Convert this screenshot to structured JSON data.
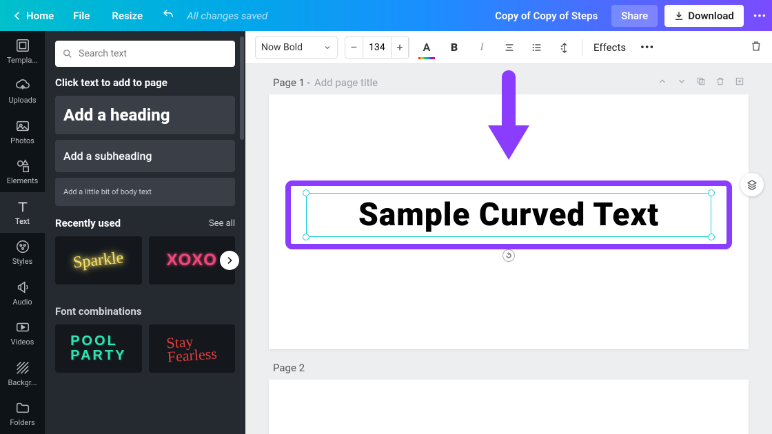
{
  "topbar": {
    "home": "Home",
    "file": "File",
    "resize": "Resize",
    "saved": "All changes saved",
    "doc_title": "Copy of Copy of Steps",
    "share": "Share",
    "download": "Download"
  },
  "rail": {
    "templates": "Templa...",
    "uploads": "Uploads",
    "photos": "Photos",
    "elements": "Elements",
    "text": "Text",
    "styles": "Styles",
    "audio": "Audio",
    "videos": "Videos",
    "background": "Backgr...",
    "folders": "Folders"
  },
  "panel": {
    "search_placeholder": "Search text",
    "click_hint": "Click text to add to page",
    "heading": "Add a heading",
    "subheading": "Add a subheading",
    "body": "Add a little bit of body text",
    "recent_label": "Recently used",
    "see_all": "See all",
    "recent_items": [
      "Sparkle",
      "XOXO"
    ],
    "combos_label": "Font combinations",
    "combo_items": [
      "POOL PARTY",
      "Stay Fearless"
    ]
  },
  "toolbar": {
    "font": "Now Bold",
    "size": "134",
    "effects": "Effects"
  },
  "canvas": {
    "page1_label": "Page 1 -",
    "page1_title_placeholder": "Add page title",
    "selected_text": "Sample Curved Text",
    "page2_label": "Page 2"
  },
  "colors": {
    "accent": "#8a3cff",
    "selection": "#18d1d6"
  }
}
